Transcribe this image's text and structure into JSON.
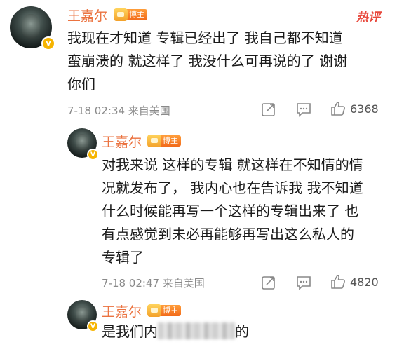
{
  "hot_label": "热评",
  "comments": [
    {
      "username": "王嘉尔",
      "badge": "博主",
      "lines": [
        "我现在才知道 专辑已经出了 我自己都不知道",
        "蛮崩溃的  就这样了 我没什么可再说的了  谢谢",
        "你们"
      ],
      "meta": "7-18 02:34  来自美国",
      "likes": "6368"
    },
    {
      "username": "王嘉尔",
      "badge": "博主",
      "lines": [
        "对我来说 这样的专辑 就这样在不知情的情",
        "况就发布了，  我内心也在告诉我 我不知道",
        "什么时候能再写一个这样的专辑出来了 也",
        "有点感觉到未必再能够再写出这么私人的",
        "专辑了"
      ],
      "meta": "7-18 02:47  来自美国",
      "likes": "4820"
    },
    {
      "username": "王嘉尔",
      "badge": "博主",
      "text_start": "是我们内",
      "text_end": "的"
    }
  ],
  "icons": {
    "share": "share-icon",
    "comment": "comment-icon",
    "like": "thumbs-up-icon"
  }
}
